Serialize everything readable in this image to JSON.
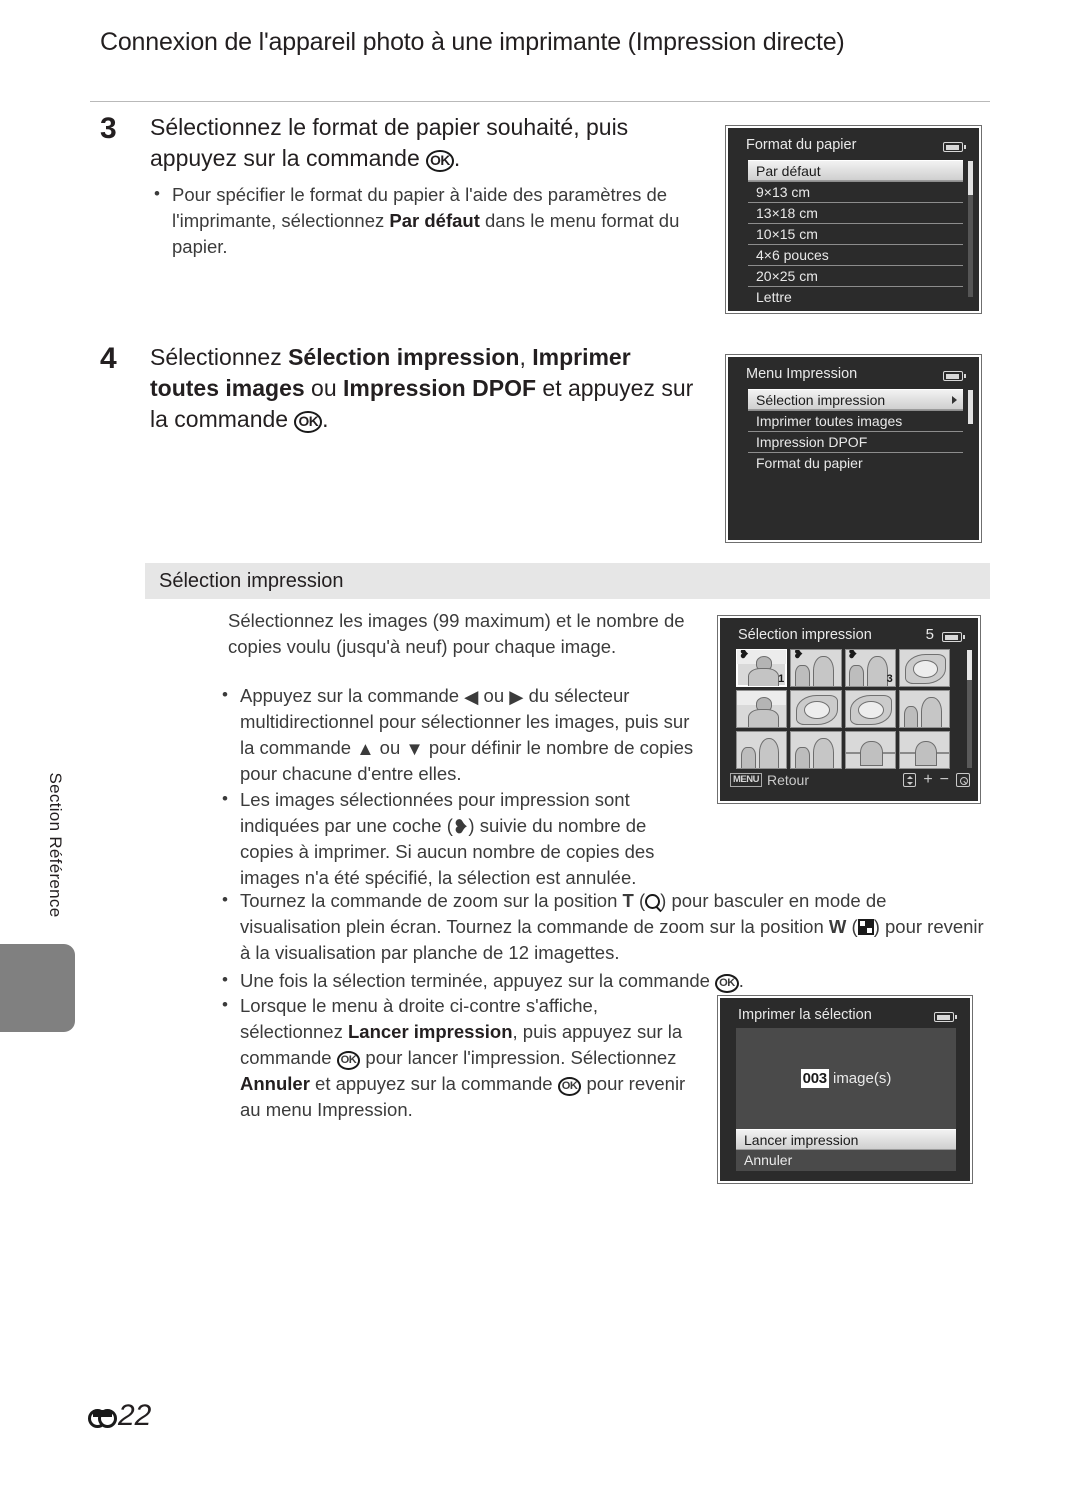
{
  "header": {
    "title": "Connexion de l'appareil photo à une imprimante (Impression directe)"
  },
  "side_tab": {
    "label": "Section Référence"
  },
  "steps": [
    {
      "number": "3",
      "title_part1": "Sélectionnez le format de papier souhaité, puis appuyez sur la commande ",
      "title_ok": "OK",
      "title_part2": ".",
      "bullets": [
        {
          "p1": "Pour spécifier le format du papier à l'aide des paramètres de l'imprimante, sélectionnez ",
          "b1": "Par défaut",
          "p2": " dans le menu format du papier."
        }
      ]
    },
    {
      "number": "4",
      "t1": "Sélectionnez ",
      "b1": "Sélection impression",
      "t2": ", ",
      "b2": "Imprimer toutes images",
      "t3": " ou ",
      "b3": "Impression DPOF",
      "t4": " et appuyez sur la commande ",
      "ok": "OK",
      "t5": "."
    }
  ],
  "section": {
    "title": "Sélection impression",
    "intro": "Sélectionnez les images (99 maximum) et le nombre de copies voulu (jusqu'à neuf) pour chaque image.",
    "bullets": {
      "b1_a": "Appuyez sur la commande ",
      "b1_left": "◀",
      "b1_b": " ou ",
      "b1_right": "▶",
      "b1_c": " du sélecteur multidirectionnel pour sélectionner les images, puis sur la commande ",
      "b1_up": "▲",
      "b1_d": " ou ",
      "b1_down": "▼",
      "b1_e": " pour définir le nombre de copies pour chacune d'entre elles.",
      "b2_a": "Les images sélectionnées pour impression sont indiquées par une coche (",
      "b2_check": "❥",
      "b2_b": ") suivie du nombre de copies à imprimer. Si aucun nombre de copies des images n'a été spécifié, la sélection est annulée.",
      "b3_a": "Tournez la commande de zoom sur la position ",
      "b3_t": "T",
      "b3_b": " (",
      "b3_c": ") pour basculer en mode de visualisation plein écran. Tournez la commande de zoom sur la position ",
      "b3_w": "W",
      "b3_d": " (",
      "b3_e": ") pour revenir à la visualisation par planche de 12 imagettes.",
      "b4_a": "Une fois la sélection terminée, appuyez sur la commande ",
      "b4_ok": "OK",
      "b4_b": ".",
      "b5_a": "Lorsque le menu à droite ci-contre s'affiche, sélectionnez ",
      "b5_bold1": "Lancer impression",
      "b5_b": ", puis appuyez sur la commande ",
      "b5_ok1": "OK",
      "b5_c": " pour lancer l'impression. Sélectionnez ",
      "b5_bold2": "Annuler",
      "b5_d": " et appuyez sur la commande ",
      "b5_ok2": "OK",
      "b5_e": " pour revenir au menu Impression."
    }
  },
  "lcd_paper": {
    "title": "Format du papier",
    "items": [
      {
        "label": "Par défaut",
        "selected": true
      },
      {
        "label": "9×13 cm",
        "selected": false
      },
      {
        "label": "13×18 cm",
        "selected": false
      },
      {
        "label": "10×15 cm",
        "selected": false
      },
      {
        "label": "4×6 pouces",
        "selected": false
      },
      {
        "label": "20×25 cm",
        "selected": false
      },
      {
        "label": "Lettre",
        "selected": false
      }
    ]
  },
  "lcd_printmenu": {
    "title": "Menu Impression",
    "items": [
      {
        "label": "Sélection impression",
        "selected": true,
        "caret": true
      },
      {
        "label": "Imprimer toutes images",
        "selected": false
      },
      {
        "label": "Impression DPOF",
        "selected": false
      },
      {
        "label": "Format du papier",
        "selected": false
      }
    ]
  },
  "lcd_selection": {
    "title": "Sélection impression",
    "count": "5",
    "menu_badge": "MENU",
    "back_label": "Retour",
    "thumbnails": [
      {
        "check": "❥",
        "count": "1",
        "current": true,
        "style": "figA"
      },
      {
        "check": "❥",
        "count": "",
        "current": false,
        "style": "figC"
      },
      {
        "check": "❥",
        "count": "3",
        "current": false,
        "style": "figC"
      },
      {
        "check": "",
        "count": "",
        "current": false,
        "style": "figE"
      },
      {
        "check": "",
        "count": "",
        "current": false,
        "style": "figA"
      },
      {
        "check": "",
        "count": "",
        "current": false,
        "style": "figE"
      },
      {
        "check": "",
        "count": "",
        "current": false,
        "style": "figE"
      },
      {
        "check": "",
        "count": "",
        "current": false,
        "style": "figC"
      },
      {
        "check": "",
        "count": "",
        "current": false,
        "style": "figC"
      },
      {
        "check": "",
        "count": "",
        "current": false,
        "style": "figC"
      },
      {
        "check": "",
        "count": "",
        "current": false,
        "style": "figD"
      },
      {
        "check": "",
        "count": "",
        "current": false,
        "style": "figD"
      }
    ]
  },
  "lcd_confirm": {
    "title": "Imprimer la sélection",
    "count_value": "003",
    "count_suffix": " image(s)",
    "buttons": [
      {
        "label": "Lancer impression",
        "selected": true
      },
      {
        "label": "Annuler",
        "selected": false
      }
    ]
  },
  "footer": {
    "page_number": "22"
  }
}
